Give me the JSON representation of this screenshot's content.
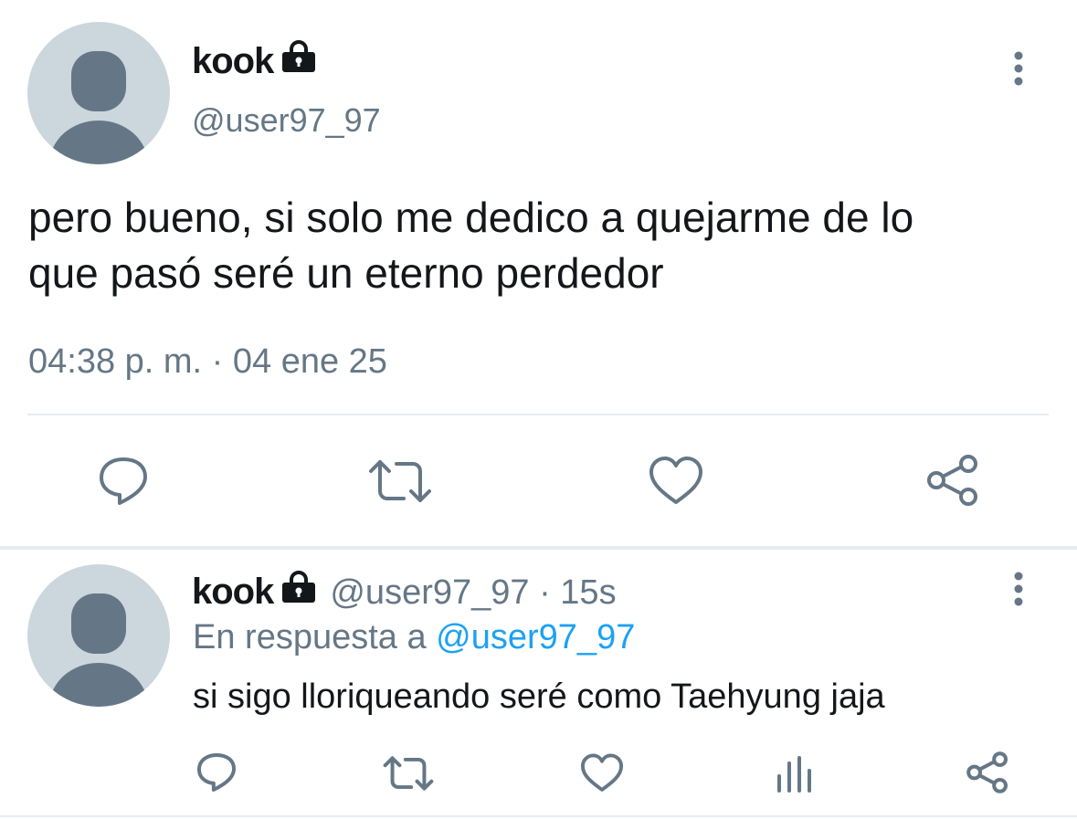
{
  "main_tweet": {
    "display_name": "kook",
    "handle": "@user97_97",
    "text_line1": "pero bueno, si solo me dedico a quejarme de lo",
    "text_line2": "que pasó seré un eterno perdedor",
    "timestamp": "04:38 p. m. · 04 ene 25",
    "icons": {
      "lock": "lock-icon",
      "more": "more-vertical-icon",
      "reply": "reply-icon",
      "retweet": "retweet-icon",
      "like": "heart-icon",
      "share": "share-icon"
    }
  },
  "reply_tweet": {
    "display_name": "kook",
    "handle_time": "@user97_97 · 15s",
    "reply_prefix": "En respuesta a",
    "reply_to": "@user97_97",
    "text": "si sigo lloriqueando seré como Taehyung jaja",
    "icons": {
      "lock": "lock-icon",
      "more": "more-vertical-icon",
      "reply": "reply-icon",
      "retweet": "retweet-icon",
      "like": "heart-icon",
      "analytics": "analytics-icon",
      "share": "share-icon"
    }
  },
  "colors": {
    "text": "#14171a",
    "secondary": "#657786",
    "link": "#1da1f2",
    "avatar_bg": "#ccd6dd",
    "avatar_fg": "#657786",
    "divider": "#e6ecf0"
  }
}
